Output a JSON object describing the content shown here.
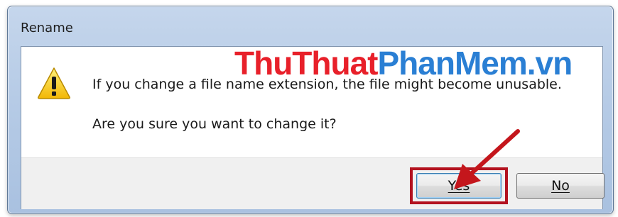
{
  "window": {
    "title": "Rename"
  },
  "watermark": {
    "part1": "ThuThuat",
    "part2": "PhanMem.vn"
  },
  "message": {
    "line1": "If you change a file name extension, the file might become unusable.",
    "line2": "Are you sure you want to change it?"
  },
  "buttons": {
    "yes_label": "Yes",
    "no_label": "No"
  },
  "icons": {
    "warning": "warning-triangle-icon",
    "arrow": "red-arrow-annotation"
  },
  "colors": {
    "highlight": "#b3121f",
    "watermark_red": "#e8202a",
    "watermark_blue": "#2a7fd4"
  }
}
